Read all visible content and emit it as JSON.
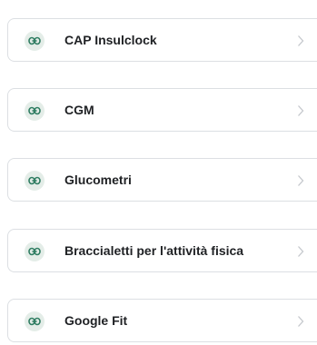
{
  "devices": {
    "items": [
      {
        "label": "CAP Insulclock",
        "icon": "link-icon"
      },
      {
        "label": "CGM",
        "icon": "link-icon"
      },
      {
        "label": "Glucometri",
        "icon": "link-icon"
      },
      {
        "label": "Braccialetti per l'attività fisica",
        "icon": "link-icon"
      },
      {
        "label": "Google Fit",
        "icon": "link-icon"
      }
    ]
  },
  "colors": {
    "icon_accent": "#2f7d62",
    "icon_bubble": "#e4ede8",
    "chevron": "#c4c7cc",
    "card_border": "#dcdfe3"
  }
}
